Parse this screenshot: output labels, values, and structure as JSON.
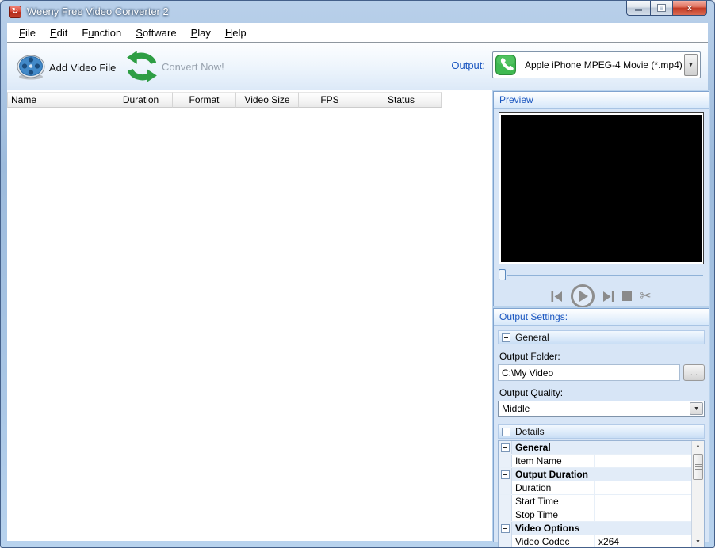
{
  "colors": {
    "accent_blue": "#1a56c0",
    "panel_border": "#7fa3cf",
    "titlebar_blue": "#9dbbdc",
    "close_red": "#c23a24",
    "convert_green": "#2e9e44",
    "phone_green": "#3fb951",
    "reel_blue": "#4289c8",
    "disabled_text": "#98a2ae"
  },
  "window": {
    "title": "Weeny Free Video Converter 2"
  },
  "icons": {
    "app_glyph": "↻",
    "close_glyph": "✕",
    "dropdown_arrow": "▼",
    "scissors_glyph": "✂",
    "scroll_up": "▲",
    "scroll_down": "▼",
    "app_icon_name": "red-refresh-arrows",
    "add_video_icon_name": "blue-film-reel",
    "convert_icon_name": "green-circular-arrows",
    "output_icon_name": "green-phone"
  },
  "menu": {
    "items": [
      {
        "pre": "",
        "u": "F",
        "post": "ile"
      },
      {
        "pre": "",
        "u": "E",
        "post": "dit"
      },
      {
        "pre": "F",
        "u": "u",
        "post": "nction"
      },
      {
        "pre": "",
        "u": "S",
        "post": "oftware"
      },
      {
        "pre": "",
        "u": "P",
        "post": "lay"
      },
      {
        "pre": "",
        "u": "H",
        "post": "elp"
      }
    ]
  },
  "toolbar": {
    "add_video_label": "Add Video File",
    "convert_label": "Convert Now!",
    "output_label": "Output:",
    "output_value": "Apple iPhone MPEG-4 Movie (*.mp4)"
  },
  "file_list": {
    "columns": [
      "Name",
      "Duration",
      "Format",
      "Video Size",
      "FPS",
      "Status"
    ]
  },
  "preview": {
    "title": "Preview"
  },
  "output_settings": {
    "title": "Output Settings:",
    "general_header": "General",
    "output_folder_label": "Output Folder:",
    "output_folder_value": "C:\\My Video",
    "browse_label": "...",
    "output_quality_label": "Output Quality:",
    "output_quality_value": "Middle",
    "details_header": "Details",
    "details_rows": [
      {
        "type": "group",
        "label": "General",
        "value": ""
      },
      {
        "type": "item",
        "label": "Item Name",
        "value": ""
      },
      {
        "type": "group",
        "label": "Output Duration",
        "value": ""
      },
      {
        "type": "item",
        "label": "Duration",
        "value": ""
      },
      {
        "type": "item",
        "label": "Start Time",
        "value": ""
      },
      {
        "type": "item",
        "label": "Stop Time",
        "value": ""
      },
      {
        "type": "group",
        "label": "Video Options",
        "value": ""
      },
      {
        "type": "item",
        "label": "Video Codec",
        "value": "x264"
      }
    ]
  }
}
